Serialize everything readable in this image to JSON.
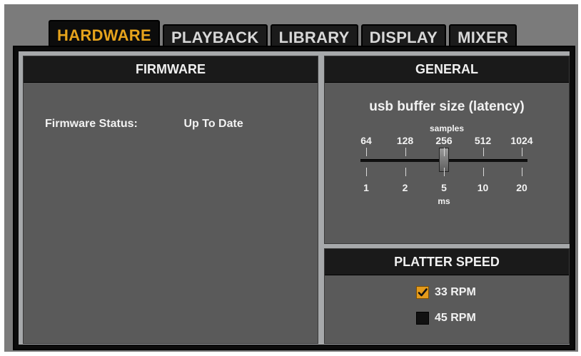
{
  "tabs": [
    {
      "label": "HARDWARE",
      "active": true
    },
    {
      "label": "PLAYBACK",
      "active": false
    },
    {
      "label": "LIBRARY",
      "active": false
    },
    {
      "label": "DISPLAY",
      "active": false
    },
    {
      "label": "MIXER",
      "active": false
    }
  ],
  "firmware": {
    "header": "FIRMWARE",
    "status_label": "Firmware Status:",
    "status_value": "Up To Date"
  },
  "general": {
    "header": "GENERAL",
    "latency_title": "usb buffer size (latency)",
    "samples_caption": "samples",
    "sample_ticks": [
      "64",
      "128",
      "256",
      "512",
      "1024"
    ],
    "ms_ticks": [
      "1",
      "2",
      "5",
      "10",
      "20"
    ],
    "ms_caption": "ms",
    "selected_sample": "256",
    "selected_ms": "5"
  },
  "platter": {
    "header": "PLATTER SPEED",
    "options": [
      {
        "label": "33 RPM",
        "checked": true
      },
      {
        "label": "45 RPM",
        "checked": false
      }
    ]
  },
  "colors": {
    "active_tab_text": "#e6a31c",
    "checkbox_checked": "#e39a1b",
    "panel_bg": "#5a5a5a",
    "header_bg": "#1a1a1a"
  },
  "icons": {
    "checkmark": "checkmark-icon"
  }
}
